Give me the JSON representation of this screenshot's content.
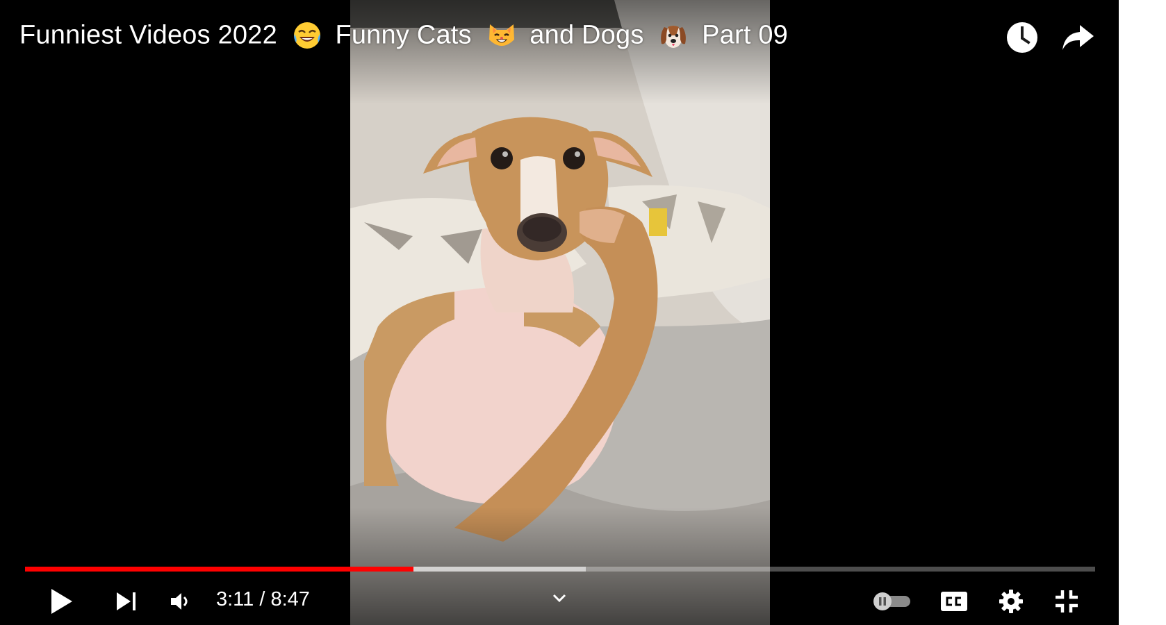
{
  "video": {
    "title_parts": [
      "Funniest Videos 2022",
      "Funny Cats",
      "and Dogs",
      "Part 09"
    ],
    "title_icons": [
      "face-with-tears-of-joy-icon",
      "cat-face-icon",
      "dog-face-icon"
    ]
  },
  "top_actions": {
    "icons": [
      "watch-later-clock-icon",
      "share-arrow-icon"
    ]
  },
  "progress": {
    "played_fraction": 0.363,
    "buffered_fraction": 0.524,
    "played_color": "#ff0000"
  },
  "controls": {
    "current_time": "3:11",
    "separator": "/",
    "duration": "8:47",
    "left_icons": [
      "play-icon",
      "next-icon",
      "volume-icon"
    ],
    "center_icon": "chevron-down-icon",
    "right_icons": [
      "autoplay-toggle-icon",
      "subtitles-cc-icon",
      "settings-gear-icon",
      "exit-fullscreen-icon"
    ]
  },
  "colors": {
    "player_bg": "#000000",
    "page_bg": "#ffffff",
    "text": "#ffffff"
  }
}
